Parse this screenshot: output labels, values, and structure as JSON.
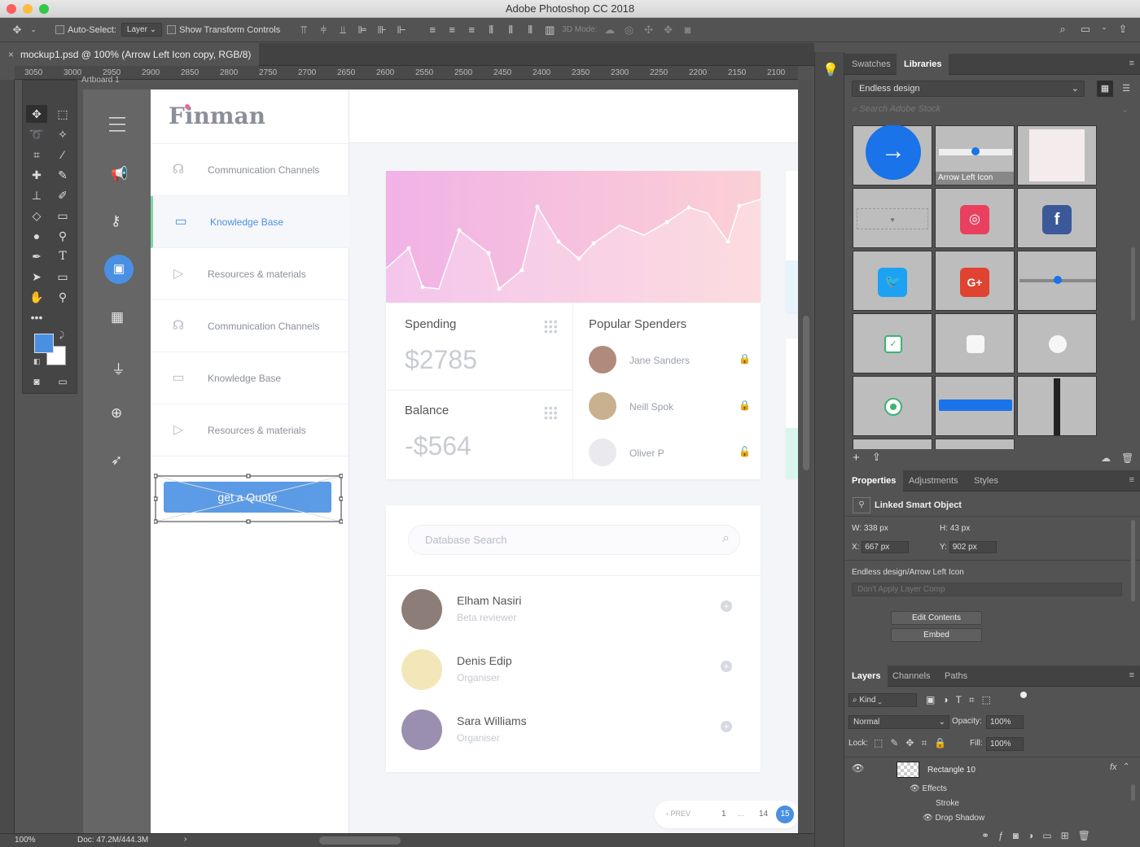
{
  "app": {
    "title": "Adobe Photoshop CC 2018"
  },
  "options_bar": {
    "auto_select_label": "Auto-Select:",
    "auto_select_value": "Layer",
    "show_transform_label": "Show Transform Controls",
    "mode_3d_label": "3D Mode:"
  },
  "document_tab": {
    "title": "mockup1.psd @ 100% (Arrow Left Icon copy, RGB/8)",
    "close": "×"
  },
  "ruler": {
    "ticks": [
      "3050",
      "3000",
      "2950",
      "2900",
      "2850",
      "2800",
      "2750",
      "2700",
      "2650",
      "2600",
      "2550",
      "2500",
      "2450",
      "2400",
      "2350",
      "2300",
      "2250",
      "2200",
      "2150",
      "2100"
    ]
  },
  "artboard": {
    "label": "Artboard 1"
  },
  "mockup": {
    "brand": "Finman",
    "brand_dot_color": "#f06595",
    "nav": [
      {
        "label": "Communication Channels",
        "icon": "headset-icon",
        "active": false
      },
      {
        "label": "Knowledge Base",
        "icon": "monitor-icon",
        "active": true
      },
      {
        "label": "Resources & materials",
        "icon": "play-icon",
        "active": false
      },
      {
        "label": "Communication Channels",
        "icon": "headset-icon",
        "active": false
      },
      {
        "label": "Knowledge Base",
        "icon": "monitor-icon",
        "active": false
      },
      {
        "label": "Resources & materials",
        "icon": "play-icon",
        "active": false
      }
    ],
    "quote_button": "get a Quote",
    "accent": "#4a90e2",
    "spending": {
      "title": "Spending",
      "value": "$2785"
    },
    "balance": {
      "title": "Balance",
      "value": "-$564"
    },
    "popular": {
      "title": "Popular Spenders",
      "people": [
        {
          "name": "Jane Sanders",
          "locked": true
        },
        {
          "name": "Neill Spok",
          "locked": true
        },
        {
          "name": "Oliver P",
          "locked": false
        }
      ]
    },
    "search": {
      "placeholder": "Database Search"
    },
    "people": [
      {
        "name": "Elham Nasiri",
        "role": "Beta reviewer"
      },
      {
        "name": "Denis Edip",
        "role": "Organiser"
      },
      {
        "name": "Sara Williams",
        "role": "Organiser"
      }
    ],
    "pagination": {
      "prev": "PREV",
      "first": "1",
      "ellipsis": "...",
      "p14": "14",
      "current": "15"
    }
  },
  "panels": {
    "libraries_tabs": [
      "Swatches",
      "Libraries"
    ],
    "library_name": "Endless design",
    "stock_placeholder": "Search Adobe Stock",
    "tile_label": "Arrow Left Icon",
    "props_tabs": [
      "Properties",
      "Adjustments",
      "Styles"
    ],
    "props_title": "Linked Smart Object",
    "w_label": "W:",
    "w": "338 px",
    "h_label": "H:",
    "h": "43 px",
    "x_label": "X:",
    "x": "667 px",
    "y_label": "Y:",
    "y": "902 px",
    "path": "Endless design/Arrow Left Icon",
    "layer_comp": "Don't Apply Layer Comp",
    "edit_contents": "Edit Contents",
    "embed": "Embed",
    "layers_tabs": [
      "Layers",
      "Channels",
      "Paths"
    ],
    "kind": "Kind",
    "blend": "Normal",
    "opacity_label": "Opacity:",
    "opacity": "100%",
    "lock_label": "Lock:",
    "fill_label": "Fill:",
    "fill": "100%",
    "layer_name": "Rectangle 10",
    "effects": "Effects",
    "stroke": "Stroke",
    "drop_shadow": "Drop Shadow"
  },
  "status": {
    "zoom": "100%",
    "doc": "Doc: 47.2M/444.3M"
  }
}
